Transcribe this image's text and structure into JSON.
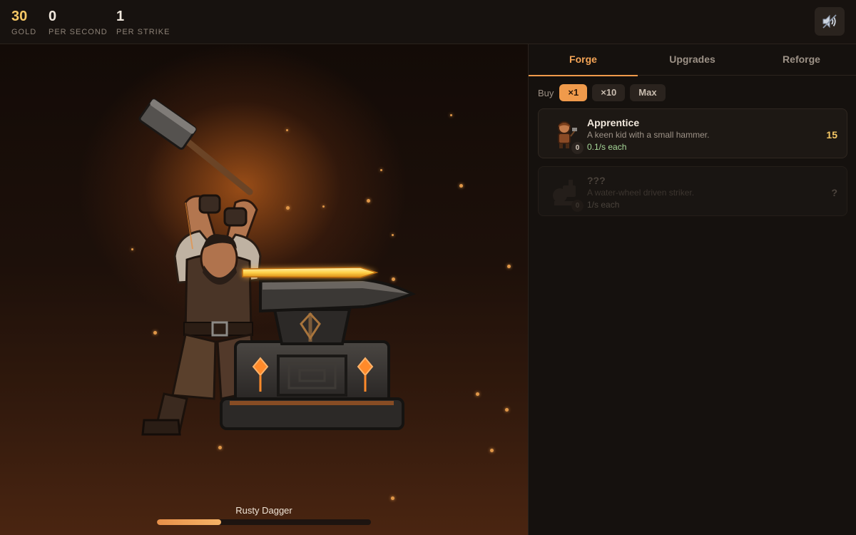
{
  "stats": {
    "gold": {
      "value": "30",
      "label": "GOLD"
    },
    "per_second": {
      "value": "0",
      "label": "PER SECOND"
    },
    "per_strike": {
      "value": "1",
      "label": "PER STRIKE"
    }
  },
  "sound_button": {
    "icon": "speaker-muted-icon"
  },
  "scene": {
    "item_name": "Rusty Dagger",
    "progress_fraction": 0.3
  },
  "tabs": [
    {
      "label": "Forge",
      "active": true
    },
    {
      "label": "Upgrades",
      "active": false
    },
    {
      "label": "Reforge",
      "active": false
    }
  ],
  "buy": {
    "label": "Buy",
    "options": [
      {
        "label": "×1",
        "selected": true
      },
      {
        "label": "×10",
        "selected": false
      },
      {
        "label": "Max",
        "selected": false
      }
    ]
  },
  "workers": [
    {
      "name": "Apprentice",
      "description": "A keen kid with a small hammer.",
      "rate": "0.1/s each",
      "cost": "15",
      "owned": "0",
      "locked": false,
      "icon": "apprentice-icon"
    },
    {
      "name": "???",
      "description": "A water-wheel driven striker.",
      "rate": "1/s each",
      "cost": "?",
      "owned": "0",
      "locked": true,
      "icon": "water-wheel-icon"
    }
  ],
  "colors": {
    "gold": "#f6c865",
    "accent": "#f09a4b",
    "rate_green": "#a8d99a",
    "background": "#120e0b"
  }
}
